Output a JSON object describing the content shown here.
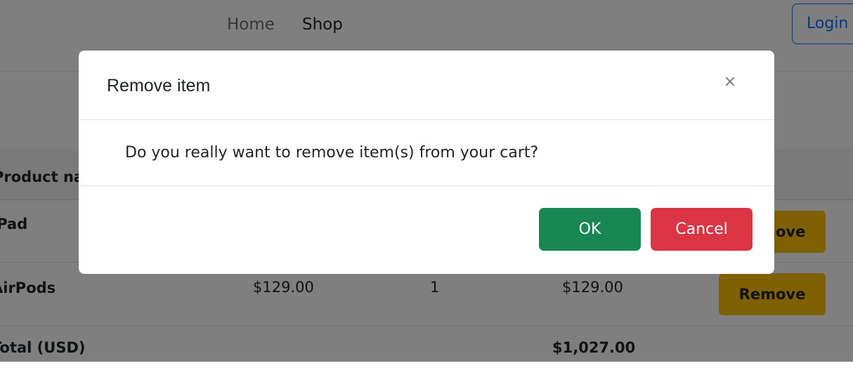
{
  "navbar": {
    "links": [
      {
        "label": "Home"
      },
      {
        "label": "Shop"
      }
    ],
    "login_label": "Login"
  },
  "cart": {
    "header": {
      "product_name": "Product name"
    },
    "rows": [
      {
        "name": "iPad",
        "price": "",
        "quantity": "",
        "subtotal": "",
        "action": "Remove"
      },
      {
        "name": "AirPods",
        "price": "$129.00",
        "quantity": "1",
        "subtotal": "$129.00",
        "action": "Remove"
      }
    ],
    "total": {
      "label": "Total (USD)",
      "amount": "$1,027.00"
    }
  },
  "modal": {
    "title": "Remove item",
    "close_symbol": "×",
    "message": "Do you really want to remove item(s) from your cart?",
    "ok_label": "OK",
    "cancel_label": "Cancel"
  },
  "colors": {
    "ok": "#198754",
    "cancel": "#dc3545",
    "remove": "#ffc107",
    "login": "#0d6efd"
  }
}
